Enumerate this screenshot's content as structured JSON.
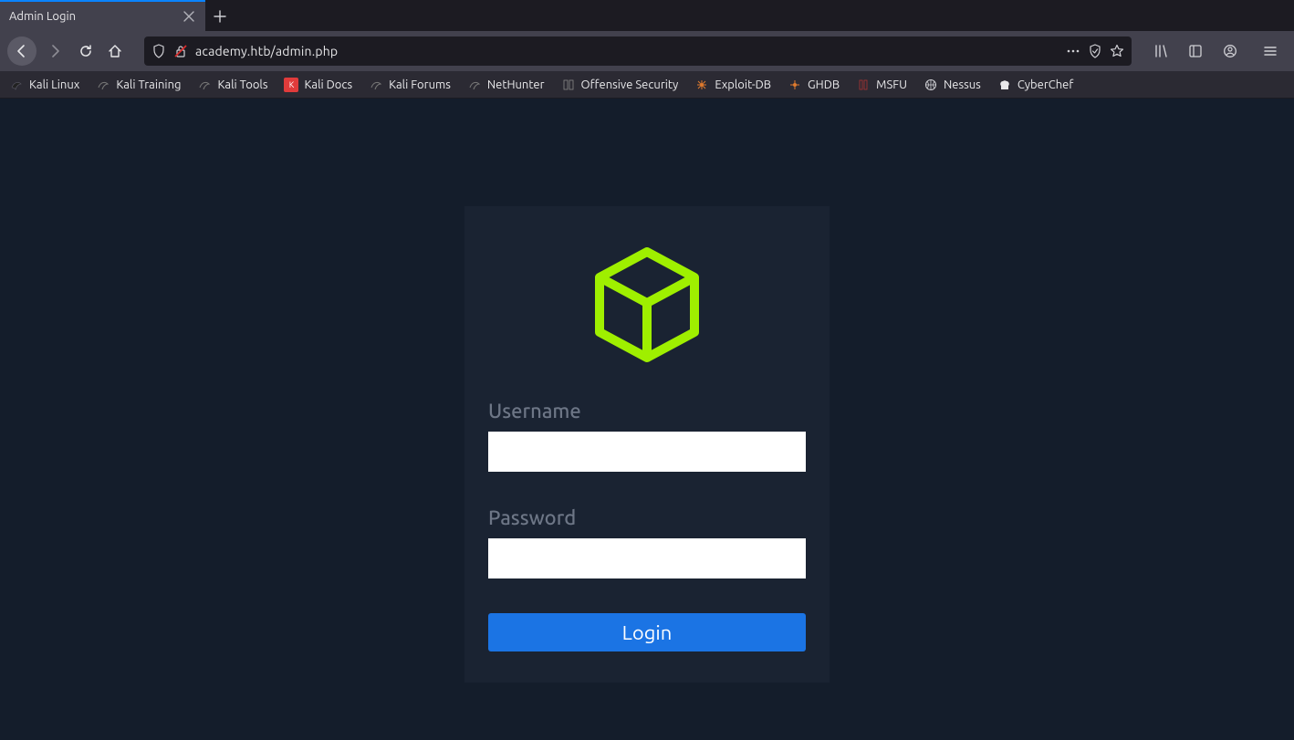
{
  "tab": {
    "title": "Admin Login"
  },
  "url": {
    "text": "academy.htb/admin.php"
  },
  "bookmarks": [
    {
      "label": "Kali Linux"
    },
    {
      "label": "Kali Training"
    },
    {
      "label": "Kali Tools"
    },
    {
      "label": "Kali Docs"
    },
    {
      "label": "Kali Forums"
    },
    {
      "label": "NetHunter"
    },
    {
      "label": "Offensive Security"
    },
    {
      "label": "Exploit-DB"
    },
    {
      "label": "GHDB"
    },
    {
      "label": "MSFU"
    },
    {
      "label": "Nessus"
    },
    {
      "label": "CyberChef"
    }
  ],
  "login": {
    "username_label": "Username",
    "password_label": "Password",
    "username_value": "",
    "password_value": "",
    "button_label": "Login"
  },
  "colors": {
    "accent": "#9fef00",
    "page_bg": "#141d2b",
    "card_bg": "#1a2332",
    "button": "#1b74e4"
  }
}
